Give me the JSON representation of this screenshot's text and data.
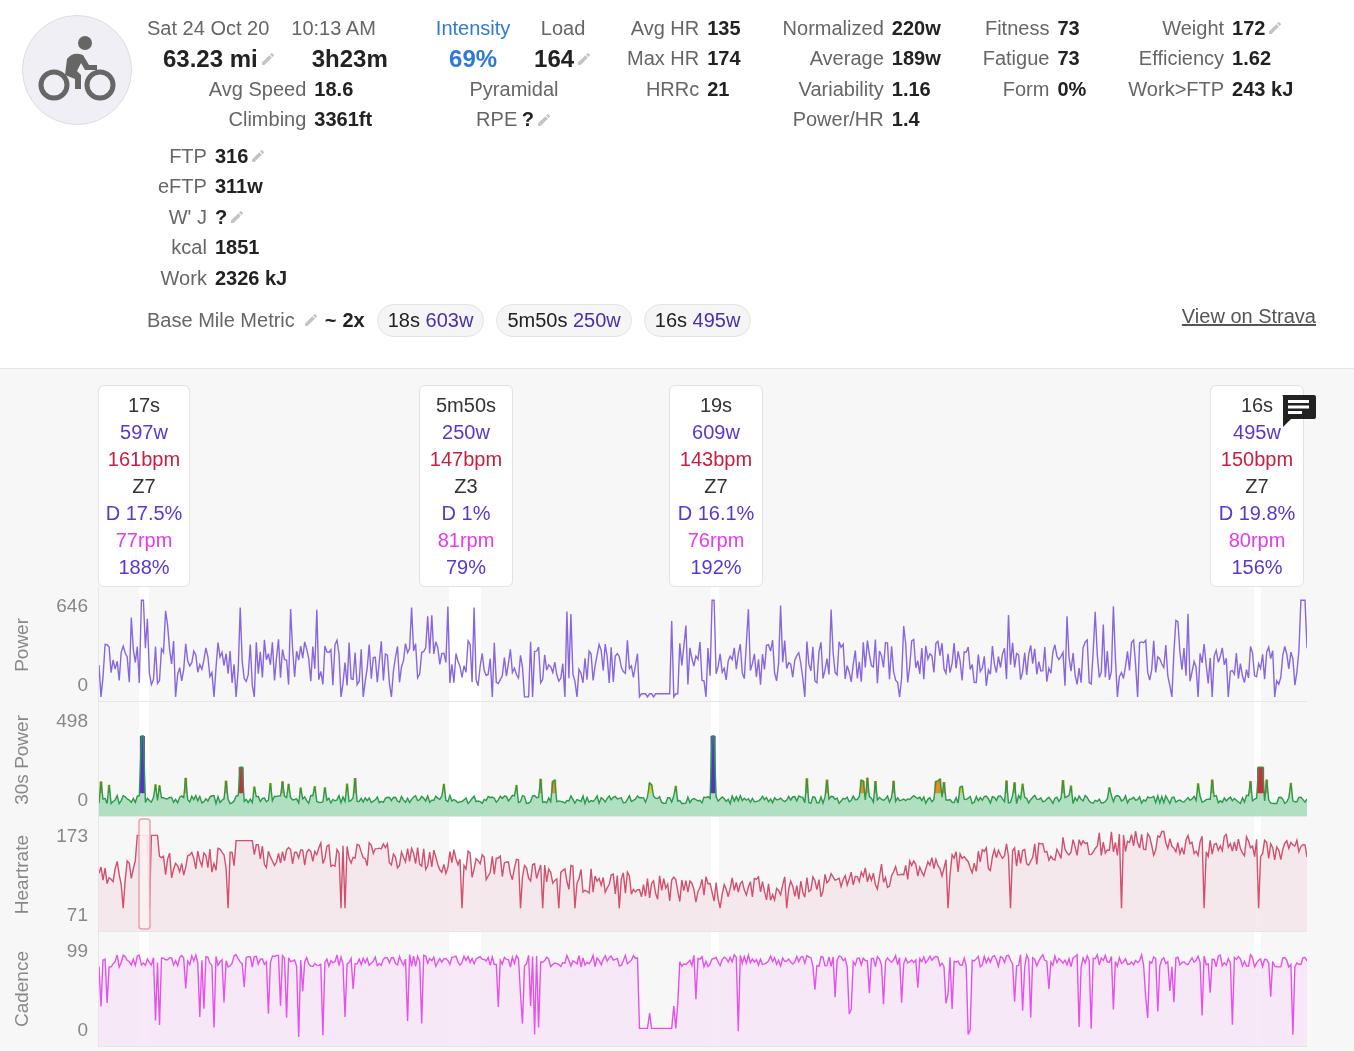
{
  "activity": {
    "date": "Sat 24 Oct 20",
    "time": "10:13 AM",
    "distance": "63.23 mi",
    "distance_editable": true,
    "duration": "3h23m",
    "stats": [
      {
        "label": "Avg Speed",
        "value": "18.6",
        "editable": false
      },
      {
        "label": "Climbing",
        "value": "3361ft",
        "editable": false
      }
    ]
  },
  "intensity": {
    "label": "Intensity",
    "value": "69%"
  },
  "load": {
    "label": "Load",
    "value": "164",
    "editable": true
  },
  "workout_type": "Pyramidal",
  "rpe": {
    "label": "RPE",
    "value": "?",
    "editable": true
  },
  "stat_groups": [
    [
      {
        "label": "Avg HR",
        "value": "135",
        "editable": false
      },
      {
        "label": "Max HR",
        "value": "174",
        "editable": false
      },
      {
        "label": "HRRc",
        "value": "21",
        "editable": false
      }
    ],
    [
      {
        "label": "Normalized",
        "value": "220w",
        "editable": false
      },
      {
        "label": "Average",
        "value": "189w",
        "editable": false
      },
      {
        "label": "Variability",
        "value": "1.16",
        "editable": false
      },
      {
        "label": "Power/HR",
        "value": "1.4",
        "editable": false
      }
    ],
    [
      {
        "label": "Fitness",
        "value": "73",
        "editable": false
      },
      {
        "label": "Fatigue",
        "value": "73",
        "editable": false
      },
      {
        "label": "Form",
        "value": "0%",
        "editable": false
      }
    ],
    [
      {
        "label": "Weight",
        "value": "172",
        "editable": true
      },
      {
        "label": "Efficiency",
        "value": "1.62",
        "editable": false
      },
      {
        "label": "Work>FTP",
        "value": "243 kJ",
        "editable": false
      }
    ]
  ],
  "extra_stats": [
    {
      "label": "FTP",
      "value": "316",
      "editable": true
    },
    {
      "label": "eFTP",
      "value": "311w",
      "editable": false
    },
    {
      "label": "W' J",
      "value": "?",
      "editable": true
    },
    {
      "label": "kcal",
      "value": "1851",
      "editable": false
    },
    {
      "label": "Work",
      "value": "2326 kJ",
      "editable": false
    }
  ],
  "tags": {
    "name": "Base Mile Metric",
    "editable": true,
    "approx": "~",
    "count": "2x",
    "intervals": [
      {
        "duration": "18s",
        "power": "603w"
      },
      {
        "duration": "5m50s",
        "power": "250w"
      },
      {
        "duration": "16s",
        "power": "495w"
      }
    ]
  },
  "strava_link": "View on Strava",
  "callouts": [
    {
      "duration": "17s",
      "power": "597w",
      "hr": "161bpm",
      "zone": "Z7",
      "decoupling": "D 17.5%",
      "cadence": "77rpm",
      "percent": "188%",
      "comment": false
    },
    {
      "duration": "5m50s",
      "power": "250w",
      "hr": "147bpm",
      "zone": "Z3",
      "decoupling": "D 1%",
      "cadence": "81rpm",
      "percent": "79%",
      "comment": false
    },
    {
      "duration": "19s",
      "power": "609w",
      "hr": "143bpm",
      "zone": "Z7",
      "decoupling": "D 16.1%",
      "cadence": "76rpm",
      "percent": "192%",
      "comment": false
    },
    {
      "duration": "16s",
      "power": "495w",
      "hr": "150bpm",
      "zone": "Z7",
      "decoupling": "D 19.8%",
      "cadence": "80rpm",
      "percent": "156%",
      "comment": true
    }
  ],
  "charts": [
    {
      "kind": "power",
      "label": "Power",
      "max": "646",
      "min": "0"
    },
    {
      "kind": "power30",
      "label": "30s Power",
      "max": "498",
      "min": "0"
    },
    {
      "kind": "heartrate",
      "label": "Heartrate",
      "max": "173",
      "min": "71"
    },
    {
      "kind": "cadence",
      "label": "Cadence",
      "max": "99",
      "min": "0"
    }
  ]
}
